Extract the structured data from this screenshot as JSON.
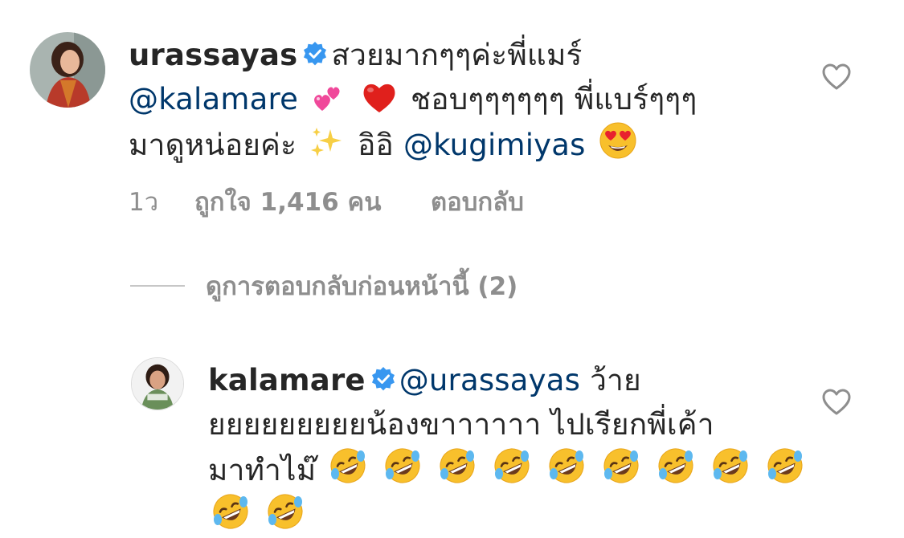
{
  "comments": [
    {
      "username": "urassayas",
      "verified": true,
      "text_1": "สวยมากๆๆค่ะพี่แมร์",
      "mention_1": "@kalamare",
      "text_2": "ชอบๆๆๆๆๆๆ พี่แบร์ๆๆๆ",
      "text_3": "มาดูหน่อยค่ะ",
      "text_4": "อิอิ",
      "mention_2": "@kugimiyas",
      "emojis": [
        "two-hearts-emoji",
        "red-heart-emoji",
        "sparkles-emoji",
        "heart-eyes-emoji"
      ],
      "meta": {
        "time": "1ว",
        "likes": "ถูกใจ 1,416 คน",
        "reply": "ตอบกลับ"
      }
    },
    {
      "username": "kalamare",
      "verified": true,
      "mention_1": "@urassayas",
      "text_1": "ว้าย",
      "text_2": "ยยยยยยยยยน้องขาาาาาา ไปเรียกพี่เค้า",
      "text_3": "มาทำไม๊",
      "emojis": [
        "rolling-on-floor-laughing-emoji x11"
      ]
    }
  ],
  "view_replies": "ดูการตอบกลับก่อนหน้านี้ (2)",
  "colors": {
    "text": "#262626",
    "mention": "#00376b",
    "meta": "#8e8e8e",
    "verified": "#3897f0",
    "divider": "#c7c7c7"
  }
}
